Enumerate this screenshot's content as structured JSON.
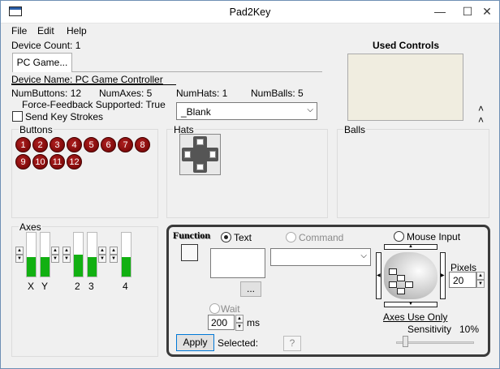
{
  "window": {
    "title": "Pad2Key",
    "minimize": "—",
    "maximize": "☐",
    "close": "✕"
  },
  "menu": {
    "file": "File",
    "edit": "Edit",
    "help": "Help"
  },
  "device": {
    "count_label": "Device Count: 1",
    "tab": "PC Game...",
    "name": "Device Name: PC Game Controller",
    "num_buttons": "NumButtons: 12",
    "num_axes": "NumAxes: 5",
    "num_hats": "NumHats: 1",
    "num_balls": "NumBalls: 5",
    "ff": "Force-Feedback Supported: True",
    "send_keys": "Send Key Strokes",
    "profile": "_Blank"
  },
  "used_controls": {
    "title": "Used Controls"
  },
  "groups": {
    "buttons": "Buttons",
    "hats": "Hats",
    "balls": "Balls",
    "axes": "Axes"
  },
  "buttons": [
    "1",
    "2",
    "3",
    "4",
    "5",
    "6",
    "7",
    "8",
    "9",
    "10",
    "11",
    "12"
  ],
  "axes": {
    "labels": [
      "X",
      "Y",
      "2",
      "3",
      "4"
    ],
    "levels": [
      0.45,
      0.45,
      0.5,
      0.45,
      0.45
    ]
  },
  "function": {
    "title": "Function",
    "text": "Text",
    "command": "Command",
    "mouse_input": "Mouse Input",
    "browse": "...",
    "wait": "Wait",
    "wait_value": "200",
    "ms": "ms",
    "pixels": "Pixels",
    "pixels_value": "20",
    "axes_use_only": "Axes Use Only",
    "sensitivity": "Sensitivity",
    "sensitivity_value": "10%",
    "apply": "Apply",
    "selected": "Selected:",
    "selected_value": "?"
  },
  "colors": {
    "accent": "#12b012",
    "button_red": "#8b0000",
    "used_controls_bg": "#f0ede0"
  }
}
